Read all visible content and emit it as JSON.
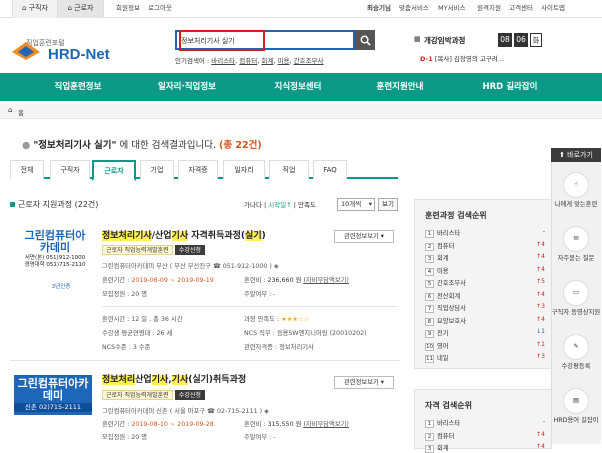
{
  "topbar": {
    "tab_jobseeker": "구직자",
    "tab_worker": "근로자",
    "member_info": "회원정보",
    "logout": "로그아웃",
    "util": [
      "최승기님",
      "맞춤서비스",
      "MY서비스",
      "원격지원",
      "고객센터",
      "사이트맵"
    ]
  },
  "logo": {
    "sub": "직업훈련포털",
    "main": "HRD-Net"
  },
  "search": {
    "value": "정보처리기사 실기",
    "popular_label": "인기검색어 :",
    "popular": [
      "바리스타",
      "컴퓨터",
      "회계",
      "미용",
      "간호조무사"
    ]
  },
  "opening": {
    "title": "개강임박과정",
    "digits": [
      "08",
      "06",
      "화"
    ],
    "news_prefix": "D-1",
    "news_text": "[복사] 김장영의 고구려..."
  },
  "nav": [
    "직업훈련정보",
    "일자리·직업정보",
    "지식정보센터",
    "훈련지원안내",
    "HRD 길라잡이"
  ],
  "breadcrumb": {
    "home": "홈"
  },
  "result": {
    "query": "정보처리기사 실기",
    "suffix": "에 대한 검색결과입니다.",
    "count": "(총 22건)"
  },
  "tabs": [
    "전체",
    "구직자",
    "근로자",
    "기업",
    "자격증",
    "일자리",
    "직업",
    "FAQ"
  ],
  "section": {
    "title": "근로자 지원과정 (22건)",
    "sort": [
      "가나다",
      "시작일",
      "만족도"
    ],
    "count_option": "10개씩",
    "view_button": "보기"
  },
  "courses": [
    {
      "logo_name": "그린컴퓨터아카데미",
      "logo_line1": "서면(본) 051)912-1000",
      "logo_line2": "경영대학 051)715-2110",
      "logo_badge": "3년인증",
      "title_pre": "정보처리기사",
      "title_mid": "/산업",
      "title_hl": "기사",
      "title_post": " 자격취득과정(",
      "title_hl2": "실기",
      "title_end": ")",
      "badge_type": "근로자 직업능력개발훈련",
      "badge_state": "수강신청",
      "org": "그린컴퓨터아카데미 부산 ( 부산 부산진구 ☎ 051-912-1000 )",
      "period_label": "훈련기간 :",
      "period": "2019-06-09 ~ 2019-09-19",
      "fee_label": "훈련비 :",
      "fee": "236,660 원",
      "fee_note": "(자비부담액보기)",
      "capacity": "모집정원 : 20 명",
      "weekend": "주말여부 : -",
      "hours": "훈련시간 : 12 일 , 총 36 시간",
      "satisfaction": "과정 만족도 :",
      "stars": 3,
      "graduates": "수강생 평균연령대 : 26 세",
      "ncs": "NCS 직무 : 응용SW엔지니어링 (20010202)",
      "ncs_level": "NCS수준 : 3 수준",
      "certificate": "관련자격증 : 정보처리기사",
      "related": "관련정보보기"
    },
    {
      "logo_name": "그린컴퓨터아카데미",
      "logo_line1": "신촌 02)715-2111",
      "title_pre": "정보처리",
      "title_mid": "산업",
      "title_hl": "기사",
      "title_post": ",",
      "title_hl2": "기사",
      "title_end": "(실기)취득과정",
      "badge_type": "근로자 직업능력개발훈련",
      "badge_state": "수강신청",
      "org": "그린컴퓨터아카데미 신촌 ( 서울 마포구 ☎ 02-715-2111 )",
      "period_label": "훈련기간 :",
      "period": "2019-08-10 ~ 2019-09-28",
      "fee_label": "훈련비 :",
      "fee": "315,550 원",
      "fee_note": "(자비부담액보기)",
      "capacity": "모집정원 : 20 명",
      "weekend": "주말여부 : -",
      "related": "관련정보보기"
    }
  ],
  "training_rank": {
    "title": "훈련과정 검색순위",
    "items": [
      {
        "n": "1",
        "label": "바리스타",
        "change": "-"
      },
      {
        "n": "2",
        "label": "컴퓨터",
        "change": "↑4"
      },
      {
        "n": "3",
        "label": "회계",
        "change": "↑4"
      },
      {
        "n": "4",
        "label": "미용",
        "change": "↑4"
      },
      {
        "n": "5",
        "label": "간호조무사",
        "change": "↑5"
      },
      {
        "n": "6",
        "label": "전산회계",
        "change": "↑4"
      },
      {
        "n": "7",
        "label": "직업상담사",
        "change": "↑3"
      },
      {
        "n": "8",
        "label": "요양보호사",
        "change": "↑4"
      },
      {
        "n": "9",
        "label": "전기",
        "change": "↓1"
      },
      {
        "n": "10",
        "label": "영어",
        "change": "↑1"
      },
      {
        "n": "11",
        "label": "네일",
        "change": "↑3"
      }
    ]
  },
  "cert_rank": {
    "title": "자격 검색순위",
    "items": [
      {
        "n": "1",
        "label": "바리스타",
        "change": "-"
      },
      {
        "n": "2",
        "label": "컴퓨터",
        "change": "↑4"
      },
      {
        "n": "3",
        "label": "회계",
        "change": "↑4"
      }
    ]
  },
  "quick": {
    "title": "바로가기",
    "items": [
      "나에게 맞는훈련",
      "자주묻는 질문",
      "구직자 동영상지원",
      "수강평등록",
      "HRD용어 길잡이"
    ]
  },
  "colors": {
    "brand": "#0c9a86",
    "blue": "#1e66b8",
    "highlight": "#d21f1f"
  }
}
